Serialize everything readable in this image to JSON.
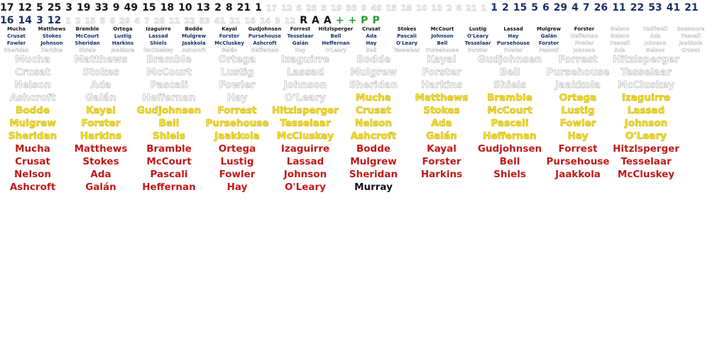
{
  "row1_numbers": [
    "17",
    "12",
    "5",
    "25",
    "3",
    "19",
    "33",
    "9",
    "49",
    "15",
    "18",
    "10",
    "13",
    "2",
    "8",
    "21",
    "1"
  ],
  "row1_ghost_numbers": [
    "17",
    "12",
    "5",
    "25",
    "3",
    "19",
    "33",
    "9",
    "49",
    "15",
    "18",
    "10",
    "13",
    "2",
    "8",
    "21",
    "1"
  ],
  "row1_navy_numbers": [
    "1",
    "2",
    "15",
    "5",
    "6",
    "29",
    "4",
    "7",
    "26",
    "11",
    "22",
    "53",
    "41",
    "21"
  ],
  "row2_navy_numbers": [
    "16",
    "14",
    "3",
    "12"
  ],
  "row2_ghost_numbers": [
    "1",
    "2",
    "15",
    "5",
    "6",
    "29",
    "4",
    "7",
    "26",
    "11",
    "22",
    "53",
    "41",
    "21",
    "16",
    "14",
    "3",
    "12"
  ],
  "row2_letters": [
    "R",
    "A",
    "A"
  ],
  "row2_green": [
    "+",
    "+",
    "P",
    "P"
  ],
  "mini_rows": [
    [
      "Mucha",
      "Matthews",
      "Bramble",
      "Ortega",
      "Izaguirre",
      "Bodde",
      "Kayal",
      "Gudjohnsen",
      "Forrest",
      "Hitzlsperger",
      "Crusat",
      "Stokes",
      "McCourt",
      "Lustig",
      "Lassad",
      "Mulgrew",
      "Forster",
      "Nelson",
      "Halliwell",
      "Bassmore"
    ],
    [
      "Crusat",
      "Stokes",
      "McCourt",
      "Lustig",
      "Lassad",
      "Mulgrew",
      "Forster",
      "Pursehouse",
      "Tesselaar",
      "Bell",
      "Ada",
      "Pascali",
      "Johnson",
      "O'Leary",
      "Hay",
      "Galán",
      "Heffernan",
      "Nelson",
      "Ada",
      "Pascali"
    ],
    [
      "Fowler",
      "Johnson",
      "Sheridan",
      "Harkins",
      "Shiels",
      "Jaakkola",
      "McCluskey",
      "Ashcroft",
      "Galán",
      "Heffernan",
      "Hay",
      "O'Leary",
      "Bell",
      "Tesselaar",
      "Pursehouse",
      "Forster",
      "Fowler",
      "Pascali",
      "Johnson",
      "Jaakkola"
    ],
    [
      "Sheridan",
      "Harkins",
      "Shiels",
      "Jaakkola",
      "McCluskey",
      "Ashcroft",
      "Galán",
      "Heffernan",
      "Hay",
      "O'Leary",
      "Bell",
      "Tesselaar",
      "Pursehouse",
      "Forster",
      "Fowler",
      "Pascali",
      "Johnson",
      "Ada",
      "Nelson",
      "Crusat"
    ]
  ],
  "ghost_grid": [
    [
      "Mucha",
      "Matthews",
      "Bramble",
      "Ortega",
      "Izaguirre",
      "Bodde",
      "Kayal",
      "Gudjohnsen",
      "Forrest",
      "Hitzlsperger"
    ],
    [
      "Crusat",
      "Stokes",
      "McCourt",
      "Lustig",
      "Lassad",
      "Mulgrew",
      "Forster",
      "Bell",
      "Pursehouse",
      "Tesselaar"
    ],
    [
      "Nelson",
      "Ada",
      "Pascali",
      "Fowler",
      "Johnson",
      "Sheridan",
      "Harkins",
      "Shiels",
      "Jaakkola",
      "McCluskey"
    ],
    [
      "Ashcroft",
      "Galán",
      "Heffernan",
      "Hay",
      "O'Leary"
    ]
  ],
  "gold_grid": [
    [
      "Mucha",
      "Matthews",
      "Bramble",
      "Ortega",
      "Izaguirre"
    ],
    [
      "Bodde",
      "Kayal",
      "Gudjohnsen",
      "Forrest",
      "Hitzlsperger",
      "Crusat",
      "Stokes",
      "McCourt",
      "Lustig",
      "Lassad"
    ],
    [
      "Mulgrew",
      "Forster",
      "Bell",
      "Pursehouse",
      "Tesselaar",
      "Nelson",
      "Ada",
      "Pascali",
      "Fowler",
      "Johnson"
    ],
    [
      "Sheridan",
      "Harkins",
      "Shiels",
      "Jaakkola",
      "McCluskey",
      "Ashcroft",
      "Galán",
      "Heffernan",
      "Hay",
      "O'Leary"
    ]
  ],
  "red_grid": [
    [
      "Mucha",
      "Matthews",
      "Bramble",
      "Ortega",
      "Izaguirre",
      "Bodde",
      "Kayal",
      "Gudjohnsen",
      "Forrest",
      "Hitzlsperger"
    ],
    [
      "Crusat",
      "Stokes",
      "McCourt",
      "Lustig",
      "Lassad",
      "Mulgrew",
      "Forster",
      "Bell",
      "Pursehouse",
      "Tesselaar"
    ],
    [
      "Nelson",
      "Ada",
      "Pascali",
      "Fowler",
      "Johnson",
      "Sheridan",
      "Harkins",
      "Shiels",
      "Jaakkola",
      "McCluskey"
    ],
    [
      "Ashcroft",
      "Galán",
      "Heffernan",
      "Hay",
      "O'Leary"
    ]
  ],
  "final_name": "Murray",
  "colors": {
    "black": "#111111",
    "navy": "#17306a",
    "ghost_stroke": "#c8c8c8",
    "gold": "#f2e530",
    "red": "#c21818",
    "green": "#2a9d2a"
  }
}
